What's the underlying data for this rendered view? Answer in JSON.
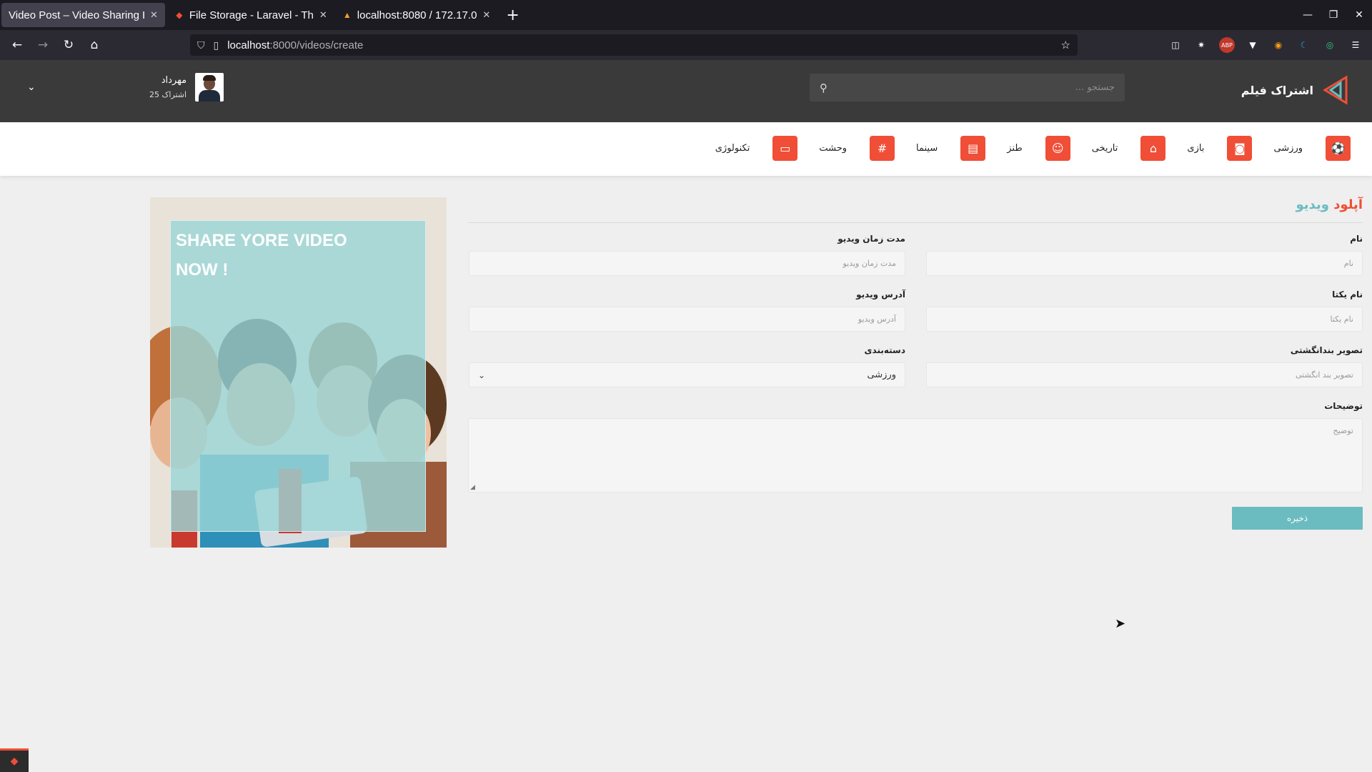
{
  "browser": {
    "tabs": [
      {
        "title": "Video Post – Video Sharing H",
        "active": true
      },
      {
        "title": "File Storage - Laravel - Th",
        "active": false
      },
      {
        "title": "localhost:8080 / 172.17.0",
        "active": false
      }
    ],
    "url_host": "localhost",
    "url_path": ":8000/videos/create"
  },
  "header": {
    "brand": "اشتراک فیلم",
    "search_placeholder": "جستجو ...",
    "user_name": "مهرداد",
    "user_subs": "25 اشتراک"
  },
  "categories": [
    {
      "label": "ورزشی",
      "icon": "soccer-ball-icon"
    },
    {
      "label": "بازی",
      "icon": "gamepad-icon"
    },
    {
      "label": "تاریخی",
      "icon": "bank-icon"
    },
    {
      "label": "طنز",
      "icon": "smile-icon"
    },
    {
      "label": "سینما",
      "icon": "film-icon"
    },
    {
      "label": "وحشت",
      "icon": "hashtag-icon"
    },
    {
      "label": "تکنولوژی",
      "icon": "laptop-icon"
    }
  ],
  "promo": {
    "line1": "SHARE YORE VIDEO",
    "line2": "NOW !"
  },
  "form": {
    "title_1": "آپلود",
    "title_2": "ویدیو",
    "name_label": "نام",
    "name_placeholder": "نام",
    "duration_label": "مدت زمان ویدیو",
    "duration_placeholder": "مدت زمان ویدیو",
    "slug_label": "نام یکتا",
    "slug_placeholder": "نام یکتا",
    "url_label": "آدرس ویدیو",
    "url_placeholder": "آدرس ویدیو",
    "thumbnail_label": "تصویر بندانگشتی",
    "thumbnail_placeholder": "تصویر بند انگشتی",
    "category_label": "دسته‌بندی",
    "category_value": "ورزشی",
    "description_label": "توضیحات",
    "description_placeholder": "توضیح",
    "save_label": "ذخیره"
  },
  "colors": {
    "accent": "#f04e36",
    "teal": "#6bbcc1",
    "header_bg": "#3a3a3a"
  }
}
